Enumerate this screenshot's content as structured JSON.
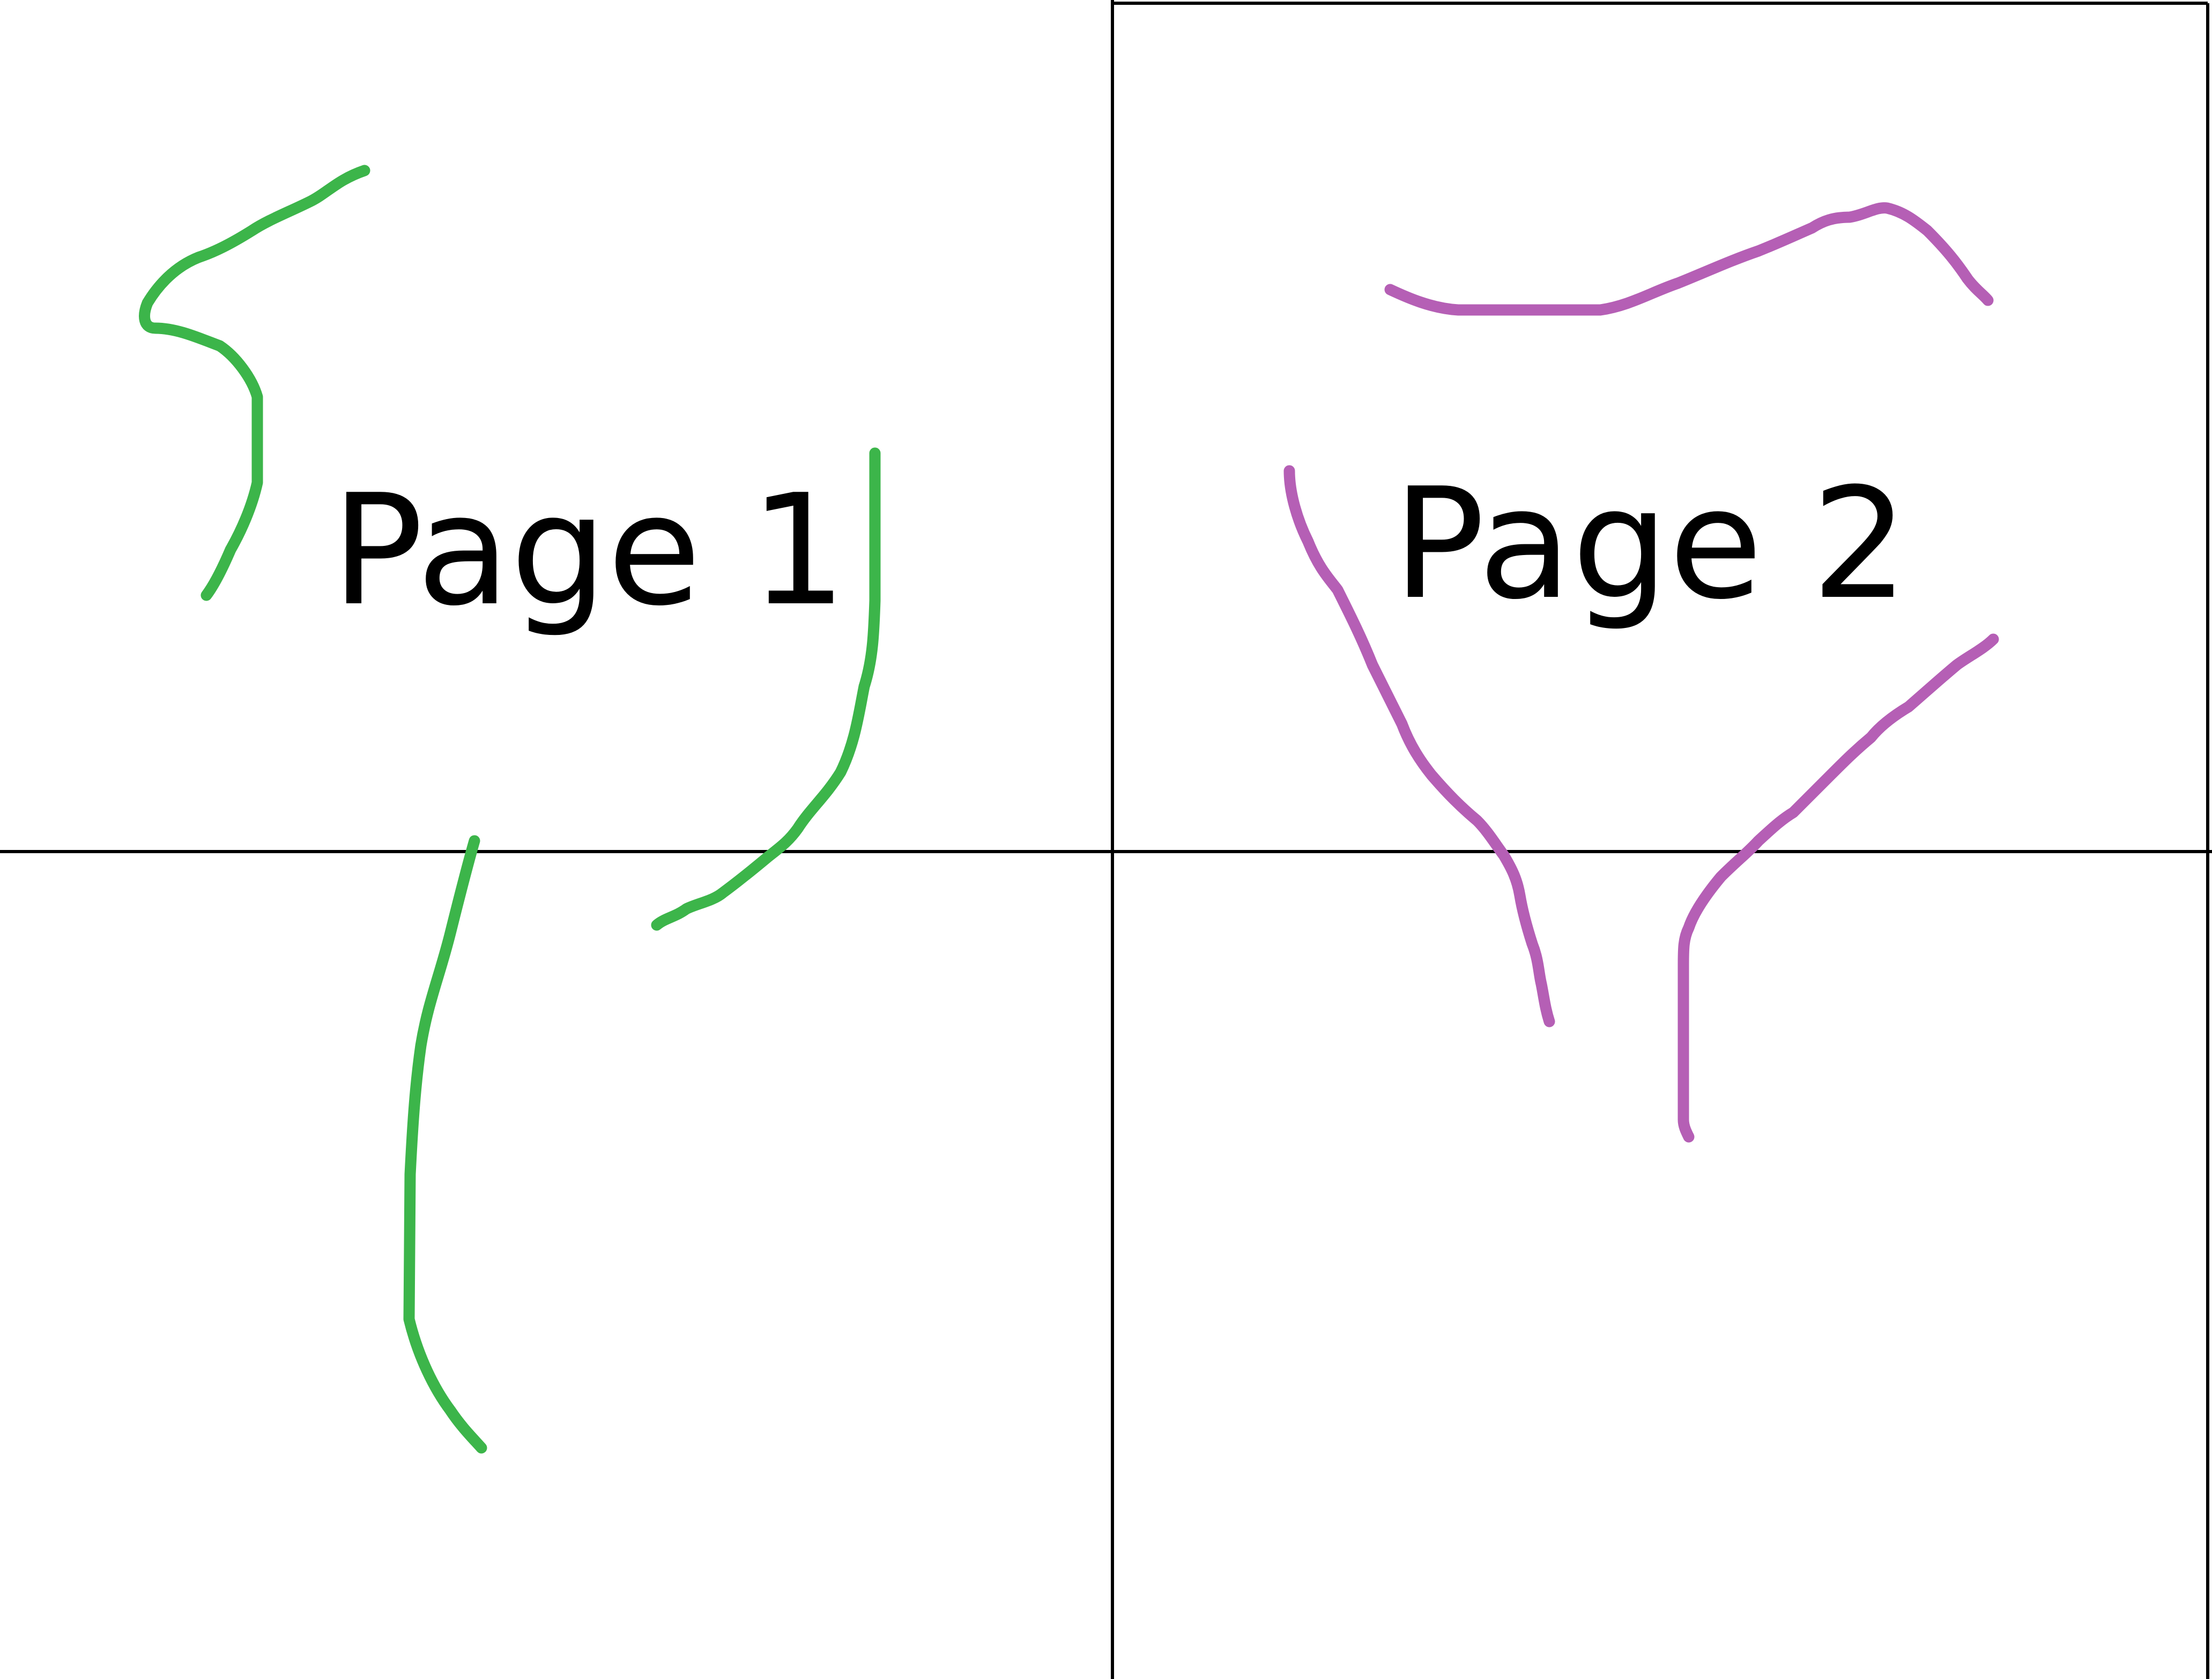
{
  "pages": [
    {
      "label": "Page 1",
      "stroke_color": "#3cb54a"
    },
    {
      "label": "Page 2",
      "stroke_color": "#b55fb5"
    }
  ],
  "grid_color": "#000000",
  "background_color": "#ffffff"
}
